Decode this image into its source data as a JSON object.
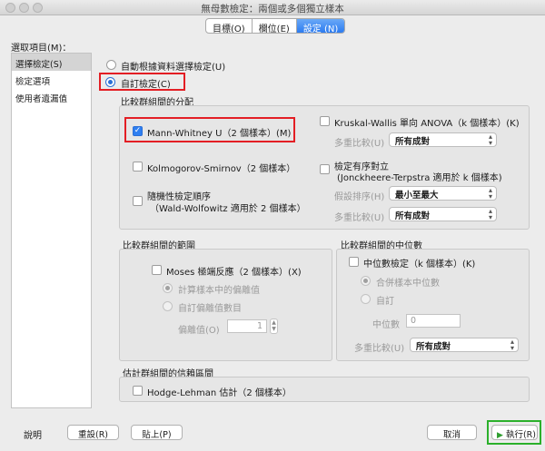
{
  "window": {
    "title": "無母數檢定：兩個或多個獨立樣本"
  },
  "tabs": [
    {
      "label": "目標(O)"
    },
    {
      "label": "欄位(E)"
    },
    {
      "label": "設定 (N)"
    }
  ],
  "sidebar": {
    "heading": "選取項目(M)：",
    "items": [
      {
        "label": "選擇檢定(S)"
      },
      {
        "label": "檢定選項"
      },
      {
        "label": "使用者遺漏值"
      }
    ]
  },
  "mode": {
    "auto_label": "自動根據資料選擇檢定(U)",
    "custom_label": "自訂檢定(C)"
  },
  "compare_dist": {
    "title": "比較群組間的分配",
    "mann_whitney": "Mann-Whitney U（2 個樣本）(M)",
    "kolmogorov": "Kolmogorov-Smirnov（2 個樣本）",
    "randomness_line1": "隨機性檢定順序",
    "randomness_line2": "（Wald-Wolfowitz 適用於 2 個樣本）",
    "kruskal": "Kruskal-Wallis 單向 ANOVA（k 個樣本）(K)",
    "multi_compare_label": "多重比較(U)",
    "multi_compare_value": "所有成對",
    "ordered_line1": "檢定有序對立",
    "ordered_line2": "(Jonckheere-Terpstra 適用於 k 個樣本)",
    "hypothesis_label": "假設排序(H)",
    "hypothesis_value": "最小至最大",
    "multi_compare2_label": "多重比較(U)",
    "multi_compare2_value": "所有成對"
  },
  "range": {
    "title": "比較群組間的範圍",
    "moses": "Moses 極端反應（2 個樣本）(X)",
    "compute_outliers": "計算樣本中的偏離值",
    "custom_outliers": "自訂偏離值數目",
    "outliers_label": "偏離值(O)",
    "outliers_value": "1"
  },
  "median": {
    "title": "比較群組間的中位數",
    "median_test": "中位數檢定（k 個樣本）(K)",
    "pooled": "合併樣本中位數",
    "custom": "自訂",
    "median_label": "中位數",
    "median_value": "0",
    "multi_compare_label": "多重比較(U)",
    "multi_compare_value": "所有成對"
  },
  "ci": {
    "title": "估計群組間的信賴區間",
    "hodges": "Hodge-Lehman 估計（2 個樣本）"
  },
  "footer": {
    "help": "說明",
    "reset": "重設(R)",
    "paste": "貼上(P)",
    "cancel": "取消",
    "run": "執行(R)",
    "run_icon": "play-icon"
  },
  "colors": {
    "accent": "#2a6fd6",
    "highlight_red": "#e31e24",
    "highlight_green": "#2bb02b",
    "run_icon": "#2f9e2f"
  }
}
